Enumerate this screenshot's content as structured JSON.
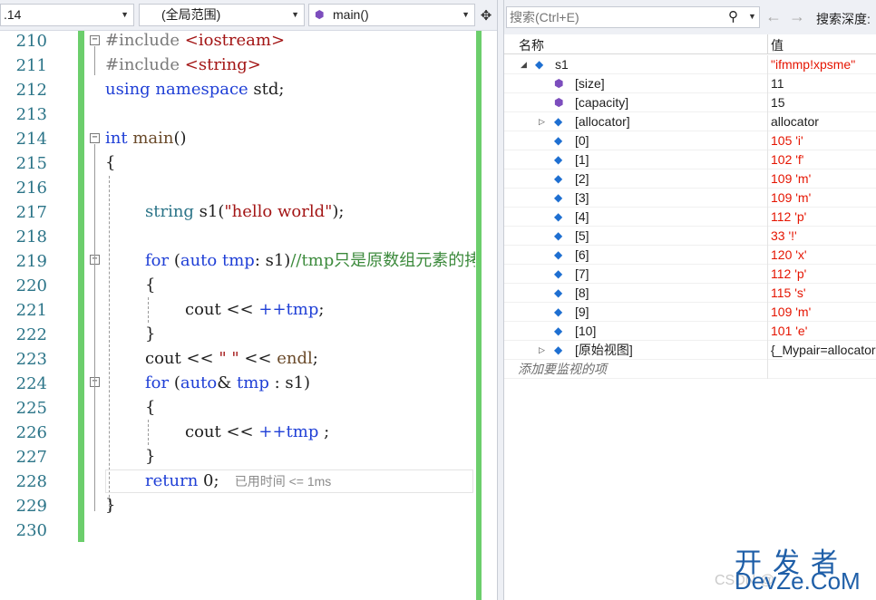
{
  "editor": {
    "nav": {
      "project_combo": ".14",
      "scope_combo": "(全局范围)",
      "function_combo": "main()"
    },
    "line_numbers": [
      "210",
      "211",
      "212",
      "213",
      "214",
      "215",
      "216",
      "217",
      "218",
      "219",
      "220",
      "221",
      "222",
      "223",
      "224",
      "225",
      "226",
      "227",
      "228",
      "229",
      "230"
    ],
    "code": {
      "l210_dir": "#include ",
      "l210_inc": "<iostream>",
      "l211_dir": "#include ",
      "l211_inc": "<string>",
      "l212_kw": "using namespace",
      "l212_rest": " std;",
      "l214_kw": "int",
      "l214_fn": " main",
      "l214_rest": "()",
      "l215": "{",
      "l217_type": "string",
      "l217_var": " s1(",
      "l217_str": "\"hello world\"",
      "l217_end": ");",
      "l219_kw": "for",
      "l219_p1": " (",
      "l219_auto": "auto",
      "l219_var": " tmp",
      "l219_p2": ": s1)",
      "l219_comment": "//tmp只是原数组元素的拷贝",
      "l220": "{",
      "l221_cout": "cout",
      "l221_op": " << ",
      "l221_inc": "++tmp",
      "l221_end": ";",
      "l222": "}",
      "l223_cout": "cout",
      "l223_op1": " << ",
      "l223_str": "\" \"",
      "l223_op2": " << ",
      "l223_endl": "endl",
      "l223_end": ";",
      "l224_kw": "for",
      "l224_p1": " (",
      "l224_auto": "auto",
      "l224_amp": "& ",
      "l224_var": "tmp",
      "l224_p2": " : s1)",
      "l225": "{",
      "l226_cout": "cout",
      "l226_op": " << ",
      "l226_inc": "++tmp",
      "l226_end": " ;",
      "l227": "}",
      "l228_kw": "return",
      "l228_rest": " 0;",
      "l228_perf": "已用时间 <= 1ms",
      "l229": "}"
    }
  },
  "watch": {
    "search_placeholder": "搜索(Ctrl+E)",
    "depth_label": "搜索深度:",
    "col_name": "名称",
    "col_value": "值",
    "rows": [
      {
        "name": "s1",
        "value": "\"ifmmp!xpsme\""
      },
      {
        "name": "[size]",
        "value": "11"
      },
      {
        "name": "[capacity]",
        "value": "15"
      },
      {
        "name": "[allocator]",
        "value": "allocator"
      },
      {
        "name": "[0]",
        "value": "105 'i'"
      },
      {
        "name": "[1]",
        "value": "102 'f'"
      },
      {
        "name": "[2]",
        "value": "109 'm'"
      },
      {
        "name": "[3]",
        "value": "109 'm'"
      },
      {
        "name": "[4]",
        "value": "112 'p'"
      },
      {
        "name": "[5]",
        "value": "33 '!'"
      },
      {
        "name": "[6]",
        "value": "120 'x'"
      },
      {
        "name": "[7]",
        "value": "112 'p'"
      },
      {
        "name": "[8]",
        "value": "115 's'"
      },
      {
        "name": "[9]",
        "value": "109 'm'"
      },
      {
        "name": "[10]",
        "value": "101 'e'"
      },
      {
        "name": "[原始视图]",
        "value": "{_Mypair=allocator"
      }
    ],
    "add_item": "添加要监视的项"
  },
  "watermark": {
    "top": "开发者",
    "bottom": "DevZe.CoM",
    "csdn": "CSDN @"
  },
  "colors": {
    "keyword": "#1f3fd6",
    "string": "#a31515",
    "comment": "#3c8a3c",
    "changed_value": "#e51400",
    "change_bar": "#6cce6c",
    "line_number": "#2b7488"
  }
}
